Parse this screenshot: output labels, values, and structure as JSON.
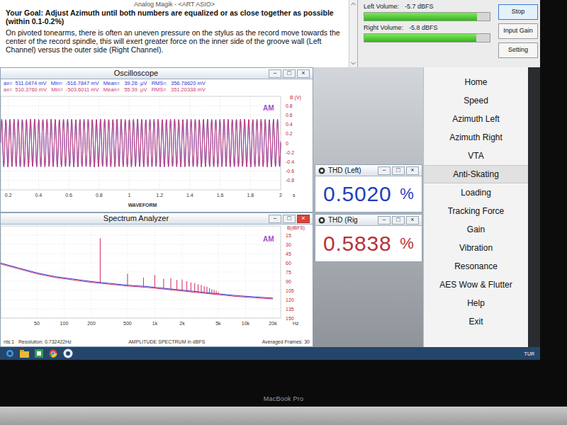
{
  "window": {
    "title": "Analog Magik - <ART ASIO>"
  },
  "instructions": {
    "goal_label": "Your Goal:",
    "goal": "Adjust Azimuth until both numbers are equalized or as close together as possible (within 0.1-0.2%)",
    "body": "On pivoted tonearms, there is often an uneven pressure on the stylus as the record move towards the center of the record spindle, this will exert greater force on the inner side of the groove wall (Left Channel) versus the outer side (Right Channel)."
  },
  "volumes": [
    {
      "label": "Left Volume:",
      "reading": "-5.7 dBFS",
      "level": 0.9
    },
    {
      "label": "Right Volume:",
      "reading": "-5.8 dBFS",
      "level": 0.89
    }
  ],
  "buttons": [
    {
      "label": "Stop",
      "selected": true
    },
    {
      "label": "Input Gain",
      "selected": false
    },
    {
      "label": "Setting",
      "selected": false
    }
  ],
  "window_buttons": [
    "−",
    "□",
    "×"
  ],
  "oscilloscope": {
    "title": "Oscilloscope",
    "active": false,
    "channels": [
      {
        "stats": "ax=  511.0474 mV   Min=  -516.7847 mV   Mean=   39.26  µV   RMS=   356.78620 mV",
        "color": "#2b3bd6",
        "amplitude_v": 0.511
      },
      {
        "stats": "ax=  510.3760 mV   Min=  -503.6011 mV   Mean=   55.39  µV   RMS=   351.20338 mV",
        "color": "#d23c6e",
        "amplitude_v": 0.51
      }
    ],
    "cycles": 68,
    "y_label": "B (V)",
    "badge": "AM",
    "y_ticks": [
      "0.8",
      "0.6",
      "0.4",
      "0.2",
      "0",
      "-0.2",
      "-0.4",
      "-0.6",
      "-0.8"
    ],
    "x_ticks": [
      "0.2",
      "0.4",
      "0.6",
      "0.8",
      "1",
      "1.2",
      "1.4",
      "1.6",
      "1.8",
      "2"
    ],
    "x_unit": "s",
    "x_label": "WAVEFORM"
  },
  "spectrum": {
    "title": "Spectrum Analyzer",
    "active": true,
    "y_label": "B(dBFS)",
    "badge": "AM",
    "y_ticks": [
      "15",
      "30",
      "45",
      "60",
      "75",
      "90",
      "105",
      "120",
      "135",
      "150"
    ],
    "x_ticks": [
      {
        "label": "50",
        "hz": 50
      },
      {
        "label": "100",
        "hz": 100
      },
      {
        "label": "200",
        "hz": 200
      },
      {
        "label": "500",
        "hz": 500
      },
      {
        "label": "1k",
        "hz": 1000
      },
      {
        "label": "2k",
        "hz": 2000
      },
      {
        "label": "5k",
        "hz": 5000
      },
      {
        "label": "10k",
        "hz": 10000
      },
      {
        "label": "20k",
        "hz": 20000
      }
    ],
    "x_unit": "Hz",
    "fundamental_hz": 250,
    "harmonics_db": [
      -20,
      -78,
      -84,
      -80,
      -86,
      -85,
      -88,
      -87,
      -90,
      -92,
      -93,
      -95,
      -96,
      -98,
      -99,
      -101,
      -103,
      -104,
      -106,
      -108
    ],
    "floor_db": [
      -62,
      -70,
      -78,
      -84,
      -88,
      -92,
      -95,
      -98,
      -100,
      -103,
      -106,
      -109,
      -112,
      -115,
      -117,
      -119
    ],
    "colors": [
      "#2b3bd6",
      "#d23c6e"
    ],
    "status": [
      "nts:1   Resolution: 0.732422Hz",
      "AMPLITUDE SPECTRUM in dBFS",
      "Averaged Frames: 30"
    ]
  },
  "thd": [
    {
      "title": "THD (Left)",
      "value": "0.5020",
      "unit": "%",
      "color": "#1f3fbf"
    },
    {
      "title": "THD (Rig",
      "value": "0.5838",
      "unit": "%",
      "color": "#b8323a"
    }
  ],
  "menu": [
    {
      "label": "Home",
      "selected": false
    },
    {
      "label": "Speed",
      "selected": false
    },
    {
      "label": "Azimuth Left",
      "selected": false
    },
    {
      "label": "Azimuth Right",
      "selected": false
    },
    {
      "label": "VTA",
      "selected": false
    },
    {
      "label": "Anti-Skating",
      "selected": true
    },
    {
      "label": "Loading",
      "selected": false
    },
    {
      "label": "Tracking Force",
      "selected": false
    },
    {
      "label": "Gain",
      "selected": false
    },
    {
      "label": "Vibration",
      "selected": false
    },
    {
      "label": "Resonance",
      "selected": false
    },
    {
      "label": "AES Wow & Flutter",
      "selected": false
    },
    {
      "label": "Help",
      "selected": false
    },
    {
      "label": "Exit",
      "selected": false
    }
  ],
  "taskbar": {
    "tray": [
      "TUR"
    ]
  },
  "bezel": {
    "label": "MacBook Pro"
  }
}
